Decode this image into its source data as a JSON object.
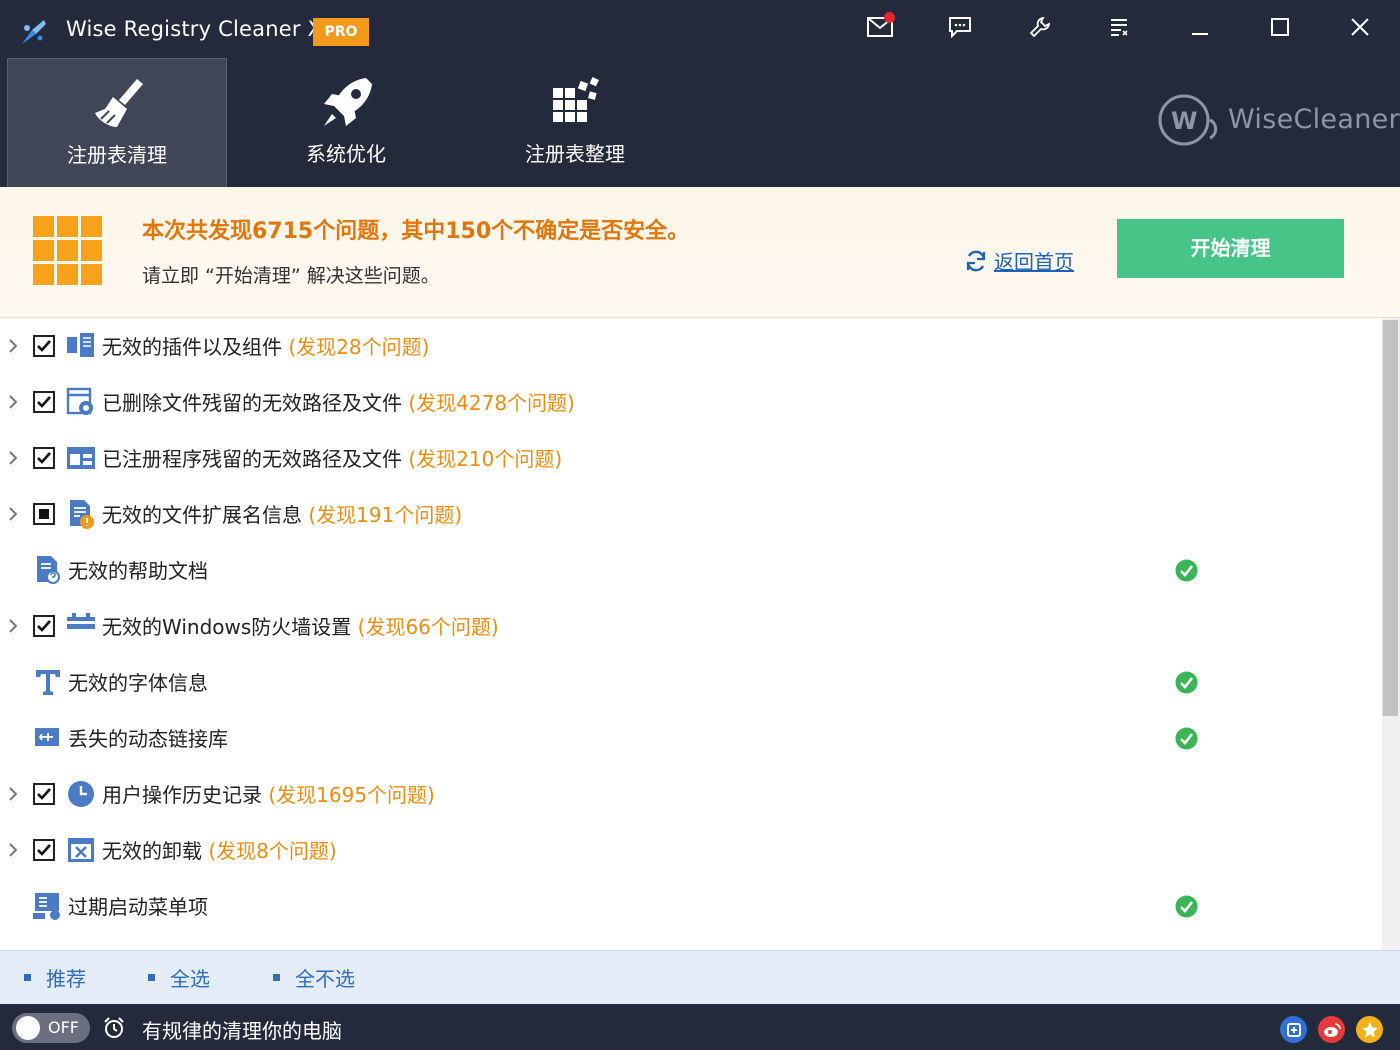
{
  "app": {
    "title": "Wise Registry Cleaner X",
    "badge": "PRO"
  },
  "tabs": [
    {
      "label": "注册表清理",
      "icon": "broom-icon",
      "active": true
    },
    {
      "label": "系统优化",
      "icon": "rocket-icon",
      "active": false
    },
    {
      "label": "注册表整理",
      "icon": "defrag-blocks-icon",
      "active": false
    }
  ],
  "brand": {
    "text": "WiseCleaner"
  },
  "banner": {
    "summary": "本次共发现6715个问题，其中150个不确定是否安全。",
    "sub": "请立即 “开始清理” 解决这些问题。",
    "back_label": "返回首页",
    "clean_label": "开始清理"
  },
  "items": [
    {
      "label": "无效的插件以及组件",
      "count": "(发现28个问题)",
      "state": "checked",
      "icon": "plugin-icon"
    },
    {
      "label": "已删除文件残留的无效路径及文件",
      "count": "(发现4278个问题)",
      "state": "checked",
      "icon": "deleted-file-icon"
    },
    {
      "label": "已注册程序残留的无效路径及文件",
      "count": "(发现210个问题)",
      "state": "checked",
      "icon": "program-window-icon"
    },
    {
      "label": "无效的文件扩展名信息",
      "count": "(发现191个问题)",
      "state": "partial",
      "icon": "file-extension-icon"
    },
    {
      "label": "无效的帮助文档",
      "count": "",
      "state": "ok",
      "icon": "help-doc-icon"
    },
    {
      "label": "无效的Windows防火墙设置",
      "count": "(发现66个问题)",
      "state": "checked",
      "icon": "firewall-icon"
    },
    {
      "label": "无效的字体信息",
      "count": "",
      "state": "ok",
      "icon": "font-icon"
    },
    {
      "label": "丢失的动态链接库",
      "count": "",
      "state": "ok",
      "icon": "dll-icon"
    },
    {
      "label": "用户操作历史记录",
      "count": "(发现1695个问题)",
      "state": "checked",
      "icon": "history-clock-icon"
    },
    {
      "label": "无效的卸载",
      "count": "(发现8个问题)",
      "state": "checked",
      "icon": "uninstall-icon"
    },
    {
      "label": "过期启动菜单项",
      "count": "",
      "state": "ok",
      "icon": "start-menu-icon"
    }
  ],
  "select_bar": {
    "recommend": "推荐",
    "select_all": "全选",
    "select_none": "全不选"
  },
  "status_bar": {
    "toggle_label": "OFF",
    "schedule_text": "有规律的清理你的电脑"
  },
  "social": [
    "tieba-icon",
    "weibo-icon",
    "favorite-star-icon"
  ],
  "colors": {
    "header": "#232a3b",
    "accent_orange": "#ee8c0f",
    "clean_button": "#47c487",
    "link_blue": "#1d63b8",
    "ok_green": "#3bb556"
  }
}
